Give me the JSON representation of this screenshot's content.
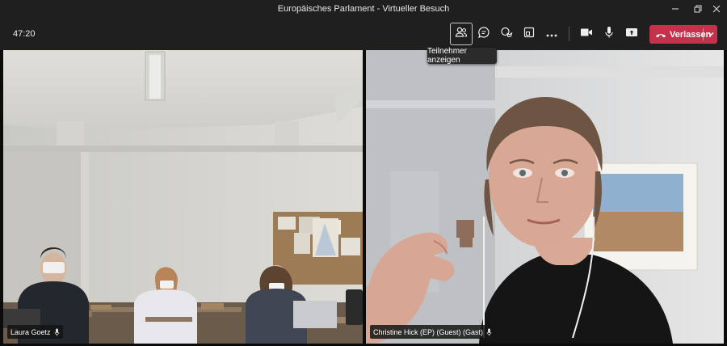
{
  "window": {
    "title": "Europäisches Parlament - Virtueller Besuch"
  },
  "toolbar": {
    "timer": "47:20",
    "leave_label": "Verlassen",
    "tooltip": "Teilnehmer anzeigen"
  },
  "participants": [
    {
      "name": "Laura Goetz"
    },
    {
      "name": "Christine Hick (EP) (Guest) (Gast)"
    }
  ],
  "colors": {
    "leave": "#c4314b",
    "chrome": "#1f1f1f",
    "background": "#0b0b0b"
  },
  "icons": [
    "minimize-icon",
    "restore-icon",
    "close-icon",
    "participants-icon",
    "chat-icon",
    "reactions-icon",
    "share-tray-icon",
    "more-icon",
    "camera-icon",
    "mic-icon",
    "share-icon",
    "phone-icon",
    "chevron-down-icon",
    "mic-small-icon"
  ]
}
